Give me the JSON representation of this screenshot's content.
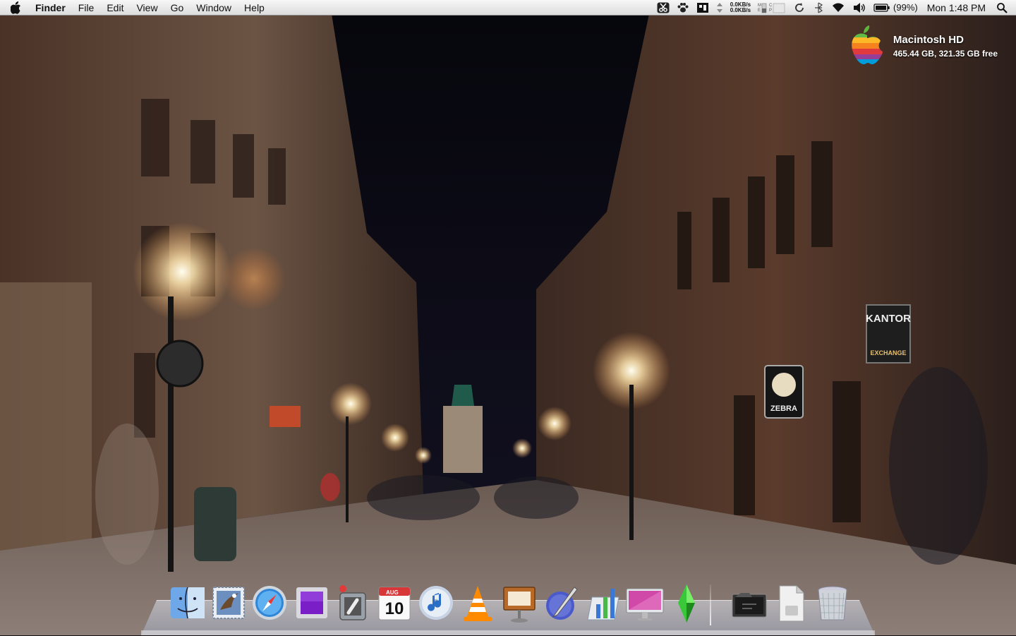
{
  "menubar": {
    "app_name": "Finder",
    "menus": [
      "File",
      "Edit",
      "View",
      "Go",
      "Window",
      "Help"
    ],
    "net_up": "0.0KB/s",
    "net_down": "0.0KB/s",
    "battery_percent": "(99%)",
    "clock": "Mon 1:48 PM",
    "icons": [
      "apple-icon",
      "scissors-icon",
      "paw-icon",
      "istat-icon",
      "network-arrows-icon",
      "mem-cpu-gauge-icon",
      "time-machine-icon",
      "bluetooth-icon",
      "wifi-icon",
      "volume-icon",
      "battery-icon",
      "spotlight-icon"
    ]
  },
  "desktop": {
    "disk_name": "Macintosh HD",
    "disk_info": "465.44 GB, 321.35 GB free"
  },
  "wallpaper": {
    "signs": {
      "kantor": "KANTOR",
      "exchange": "EXCHANGE",
      "zebra": "ZEBRA"
    }
  },
  "dock": {
    "calendar_month": "AUG",
    "calendar_day": "10",
    "items": [
      "finder-icon",
      "mail-icon",
      "safari-icon",
      "purple-app-icon",
      "switch-app-icon",
      "ical-icon",
      "itunes-icon",
      "vlc-icon",
      "keynote-icon",
      "pen-app-icon",
      "numbers-icon",
      "imac-display-icon",
      "sims-icon",
      "media-folder-icon",
      "doc-file-icon",
      "trash-icon"
    ]
  }
}
